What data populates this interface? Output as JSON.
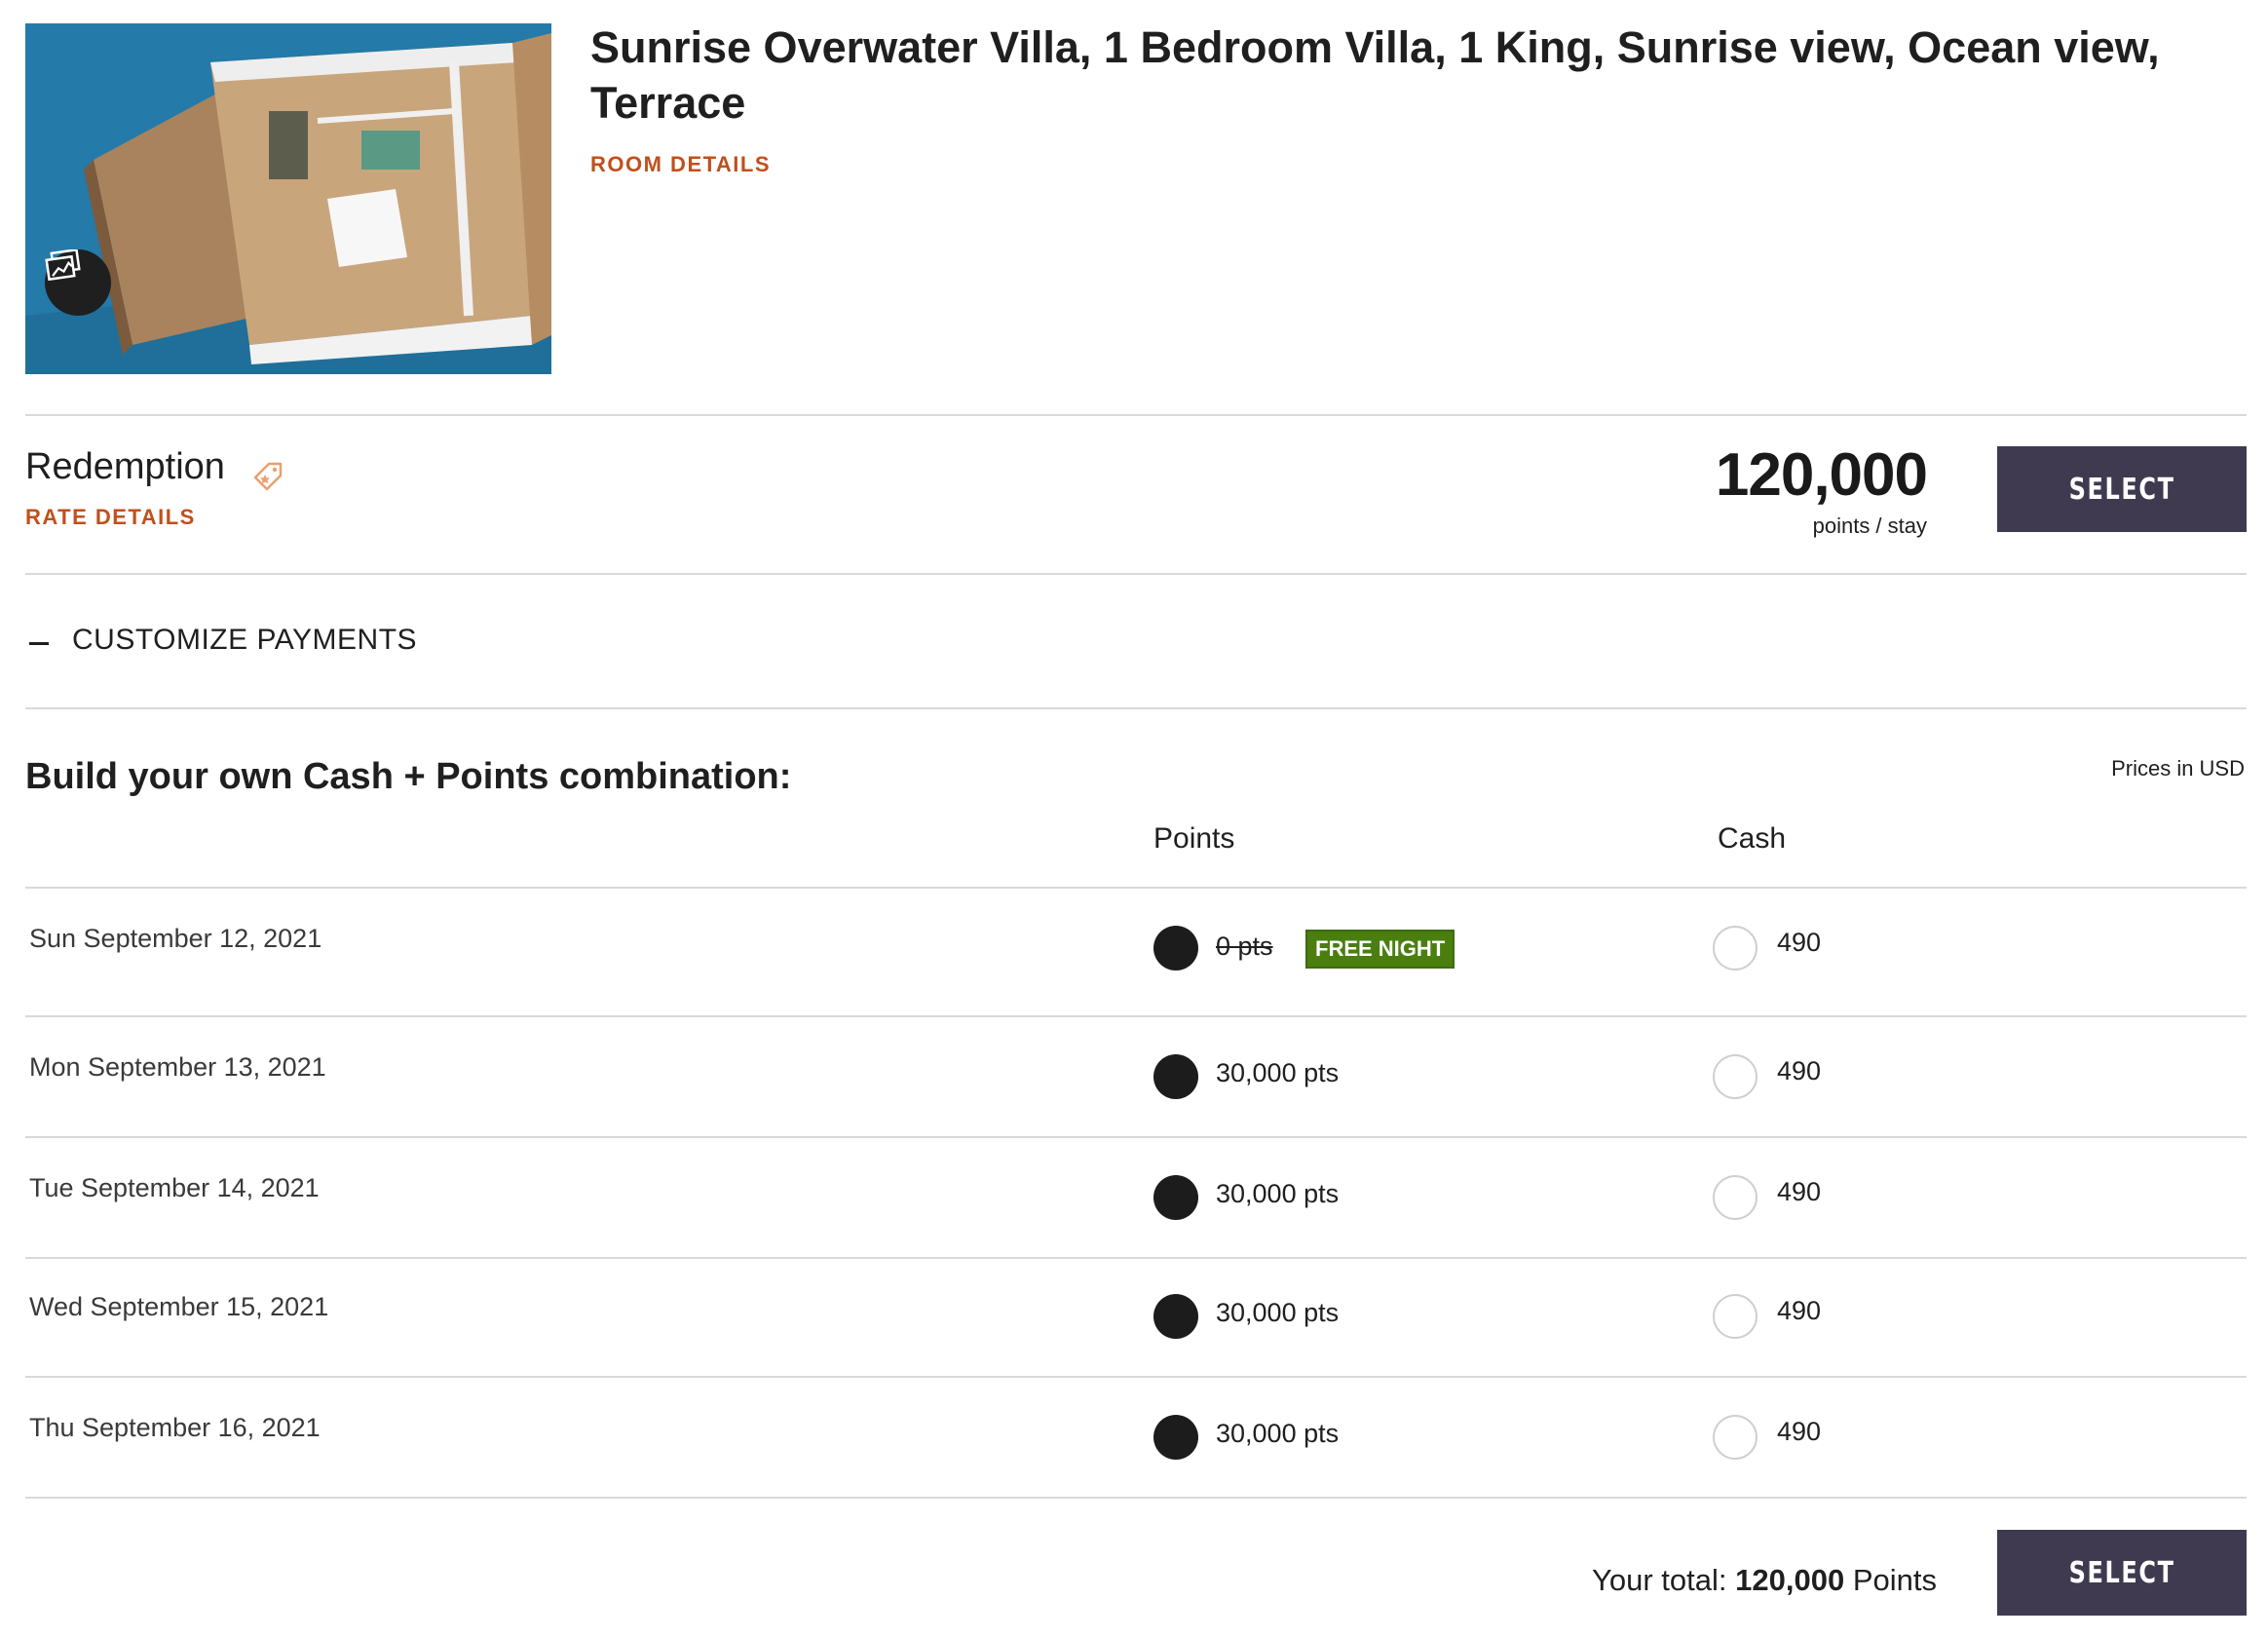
{
  "room": {
    "title": "Sunrise Overwater Villa, 1 Bedroom Villa, 1 King, Sunrise view, Ocean view, Terrace",
    "details_link": "ROOM DETAILS",
    "gallery_icon": "image-gallery-icon"
  },
  "rate": {
    "name": "Redemption",
    "tag_icon": "tag-icon",
    "details_link": "RATE DETAILS",
    "points": "120,000",
    "unit": "points / stay",
    "select_label": "SELECT"
  },
  "customize": {
    "label": "CUSTOMIZE PAYMENTS",
    "heading": "Build your own Cash + Points combination:",
    "currency_note": "Prices in USD",
    "columns": {
      "points": "Points",
      "cash": "Cash"
    },
    "rows": [
      {
        "date": "Sun September 12, 2021",
        "points": "0 pts",
        "badge": "FREE NIGHT",
        "cash": "490"
      },
      {
        "date": "Mon September 13, 2021",
        "points": "30,000 pts",
        "cash": "490"
      },
      {
        "date": "Tue September 14, 2021",
        "points": "30,000 pts",
        "cash": "490"
      },
      {
        "date": "Wed September 15, 2021",
        "points": "30,000 pts",
        "cash": "490"
      },
      {
        "date": "Thu September 16, 2021",
        "points": "30,000 pts",
        "cash": "490"
      }
    ],
    "total_label": "Your total:",
    "total_value": "120,000",
    "total_unit": "Points",
    "select_label": "SELECT"
  },
  "colors": {
    "accent_link": "#c0501c",
    "button_bg": "#3f3a50",
    "badge_green": "#4a7f10"
  }
}
